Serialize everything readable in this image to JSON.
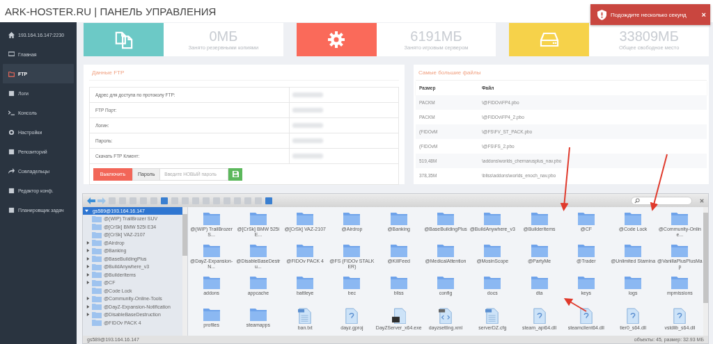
{
  "header": {
    "title": "ARK-HOSTER.RU | ПАНЕЛЬ УПРАВЛЕНИЯ"
  },
  "toast": {
    "message": "Подождите несколько секунд",
    "close": "×"
  },
  "sidebar": {
    "items": [
      {
        "label": "193.164.16.147:2230",
        "selected": false
      },
      {
        "label": "Главная",
        "selected": false
      },
      {
        "label": "FTP",
        "selected": true
      },
      {
        "label": "Логи",
        "selected": false
      },
      {
        "label": "Консоль",
        "selected": false
      },
      {
        "label": "Настройки",
        "selected": false
      },
      {
        "label": "Репозиторий",
        "selected": false
      },
      {
        "label": "Совладельцы",
        "selected": false
      },
      {
        "label": "Редактор конф.",
        "selected": false
      },
      {
        "label": "Планировщик задач",
        "selected": false
      }
    ]
  },
  "stats": [
    {
      "value": "0МБ",
      "label": "Занято резервными копиями",
      "color": "#6cc9c6"
    },
    {
      "value": "6191МБ",
      "label": "Занято игровым сервером",
      "color": "#fa6a5a"
    },
    {
      "value": "33809МБ",
      "label": "Общее свободное место",
      "color": "#f6d24a"
    }
  ],
  "ftp": {
    "title": "Данные FTP",
    "rows": [
      "Адрес для доступа по протоколу FTP:",
      "FTP Порт:",
      "Логин:",
      "Пароль:",
      "Скачать FTP Клиент:"
    ],
    "disable_button": "Выключить",
    "password_label": "Пароль",
    "password_placeholder": "Введите НОВЫЙ пароль"
  },
  "largest_files": {
    "title": "Самые большие файлы",
    "columns": [
      "Размер",
      "Файл"
    ],
    "rows": [
      [
        "PACKM",
        "\\@FIDOv\\FP4.pbo"
      ],
      [
        "PACKM",
        "\\@FIDOv\\FP4_2.pbo"
      ],
      [
        "(FIDOvM",
        "\\@FS\\FV_ST_PACK.pbo"
      ],
      [
        "(FIDOvM",
        "\\@FS\\FS_2.pbo"
      ],
      [
        "519,48M",
        "\\addons\\worlds_chernarusplus_nav.pbo"
      ],
      [
        "378,35M",
        "\\bliss\\addons\\worlds_enoch_nav.pbo"
      ]
    ]
  },
  "file_manager": {
    "tree": [
      {
        "label": "gs589@193.164.16.147",
        "selected": true,
        "expanded": true,
        "children": [
          {
            "label": "@(WIP) TrailBrozer SUV",
            "expandable": false
          },
          {
            "label": "@[CrSk] BMW 525i E34",
            "expandable": false
          },
          {
            "label": "@[CrSk] VAZ-2107",
            "expandable": false
          },
          {
            "label": "@Airdrop",
            "expandable": true
          },
          {
            "label": "@Banking",
            "expandable": true
          },
          {
            "label": "@BaseBuildingPlus",
            "expandable": true
          },
          {
            "label": "@BuildAnywhere_v3",
            "expandable": true
          },
          {
            "label": "@BuilderItems",
            "expandable": true
          },
          {
            "label": "@CF",
            "expandable": true
          },
          {
            "label": "@Code Lock",
            "expandable": false
          },
          {
            "label": "@Community-Online-Tools",
            "expandable": true
          },
          {
            "label": "@DayZ-Expansion-Notification",
            "expandable": true
          },
          {
            "label": "@DisableBaseDestruction",
            "expandable": true
          },
          {
            "label": "@FIDOv PACK 4",
            "expandable": false
          }
        ]
      }
    ],
    "items": [
      {
        "name": "@(WIP) TrailBrozer S...",
        "kind": "folder"
      },
      {
        "name": "@[CrSk] BMW 525i E...",
        "kind": "folder"
      },
      {
        "name": "@[CrSk] VAZ-2107",
        "kind": "folder"
      },
      {
        "name": "@Airdrop",
        "kind": "folder"
      },
      {
        "name": "@Banking",
        "kind": "folder"
      },
      {
        "name": "@BaseBuildingPlus",
        "kind": "folder"
      },
      {
        "name": "@BuildAnywhere_v3",
        "kind": "folder"
      },
      {
        "name": "@BuilderItems",
        "kind": "folder"
      },
      {
        "name": "@CF",
        "kind": "folder"
      },
      {
        "name": "@Code Lock",
        "kind": "folder"
      },
      {
        "name": "@Community-Online...",
        "kind": "folder"
      },
      {
        "name": "@DayZ-Expansion-N...",
        "kind": "folder"
      },
      {
        "name": "@DisableBaseDestru...",
        "kind": "folder"
      },
      {
        "name": "@FIDOv PACK 4",
        "kind": "folder"
      },
      {
        "name": "@FS (FIDOv STALKER)",
        "kind": "folder"
      },
      {
        "name": "@KillFeed",
        "kind": "folder"
      },
      {
        "name": "@MedicalAttention",
        "kind": "folder"
      },
      {
        "name": "@MosinScope",
        "kind": "folder"
      },
      {
        "name": "@PartyMe",
        "kind": "folder"
      },
      {
        "name": "@Trader",
        "kind": "folder"
      },
      {
        "name": "@Unlimited Stamina",
        "kind": "folder"
      },
      {
        "name": "@VanillaPlusPlusMap",
        "kind": "folder"
      },
      {
        "name": "addons",
        "kind": "folder"
      },
      {
        "name": "appcache",
        "kind": "folder"
      },
      {
        "name": "battleye",
        "kind": "folder"
      },
      {
        "name": "bec",
        "kind": "folder"
      },
      {
        "name": "bliss",
        "kind": "folder"
      },
      {
        "name": "config",
        "kind": "folder"
      },
      {
        "name": "docs",
        "kind": "folder"
      },
      {
        "name": "dta",
        "kind": "folder"
      },
      {
        "name": "keys",
        "kind": "folder"
      },
      {
        "name": "logs",
        "kind": "folder"
      },
      {
        "name": "mpmissions",
        "kind": "folder"
      },
      {
        "name": "profiles",
        "kind": "folder"
      },
      {
        "name": "steamapps",
        "kind": "folder"
      },
      {
        "name": "ban.txt",
        "kind": "text"
      },
      {
        "name": "dayz.gproj",
        "kind": "unknown"
      },
      {
        "name": "DayZServer_x64.exe",
        "kind": "exe"
      },
      {
        "name": "dayzsetting.xml",
        "kind": "code"
      },
      {
        "name": "serverDZ.cfg",
        "kind": "text"
      },
      {
        "name": "steam_api64.dll",
        "kind": "unknown"
      },
      {
        "name": "steamclient64.dll",
        "kind": "unknown"
      },
      {
        "name": "tier0_s64.dll",
        "kind": "unknown"
      },
      {
        "name": "vstdlib_s64.dll",
        "kind": "unknown"
      }
    ],
    "status_left": "gs589@193.164.16.147",
    "status_right": "объекты: 45, размер: 32.93 МБ"
  },
  "annotations": [
    {
      "kind": "arrow"
    },
    {
      "kind": "arrow"
    },
    {
      "kind": "arrow"
    }
  ]
}
